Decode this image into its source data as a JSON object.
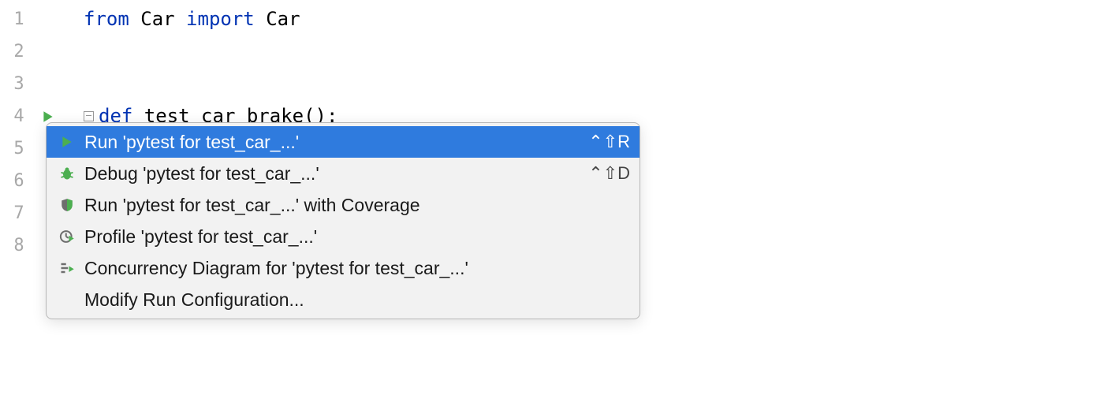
{
  "lines": [
    "1",
    "2",
    "3",
    "4",
    "5",
    "6",
    "7",
    "8"
  ],
  "code": {
    "l1_from": "from",
    "l1_mod": " Car ",
    "l1_import": "import",
    "l1_name": " Car",
    "l4_def": "def",
    "l4_rest": " test_car_brake():"
  },
  "menu": {
    "run": {
      "label": "Run 'pytest for test_car_...'",
      "shortcut": "⌃⇧R"
    },
    "debug": {
      "label": "Debug 'pytest for test_car_...'",
      "shortcut": "⌃⇧D"
    },
    "coverage": {
      "label": "Run 'pytest for test_car_...' with Coverage"
    },
    "profile": {
      "label": "Profile 'pytest for test_car_...'"
    },
    "conc": {
      "label": "Concurrency Diagram for 'pytest for test_car_...'"
    },
    "modify": {
      "label": "Modify Run Configuration..."
    }
  }
}
